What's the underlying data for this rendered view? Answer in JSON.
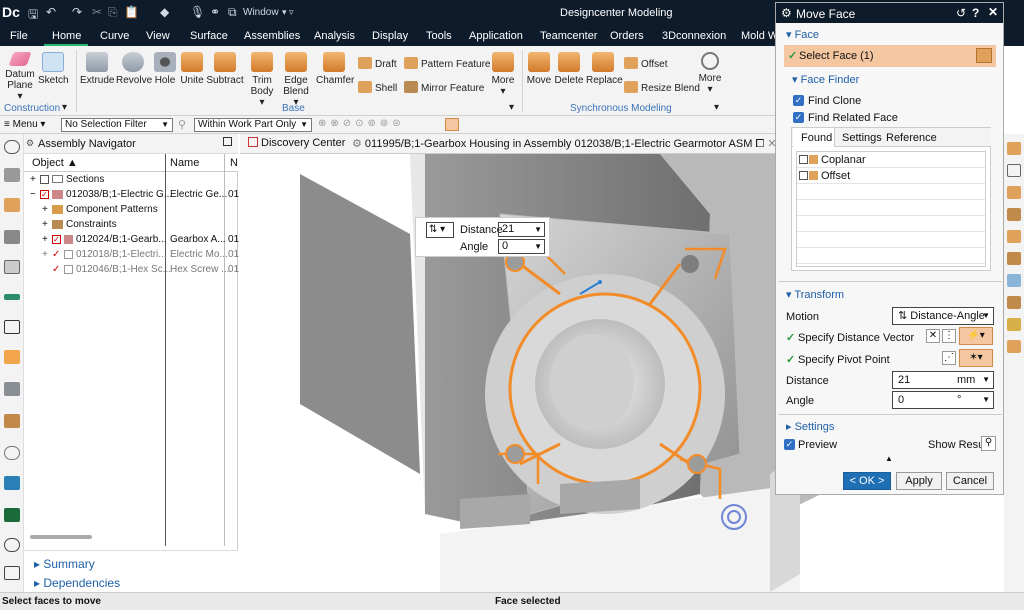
{
  "app": {
    "logo": "Dc",
    "title": "Designcenter Modeling",
    "window_menu": "Window"
  },
  "menu": [
    "File",
    "Home",
    "Curve",
    "View",
    "Surface",
    "Assemblies",
    "Analysis",
    "Display",
    "Tools",
    "Application",
    "Teamcenter",
    "Orders",
    "3Dconnexion",
    "Mold W"
  ],
  "ribbon": {
    "construction": {
      "datum_plane": "Datum",
      "datum_plane2": "Plane",
      "sketch": "Sketch",
      "label": "Construction"
    },
    "base": {
      "extrude": "Extrude",
      "revolve": "Revolve",
      "hole": "Hole",
      "unite": "Unite",
      "subtract": "Subtract",
      "trim_body": "Trim",
      "trim_body2": "Body",
      "edge_blend": "Edge",
      "edge_blend2": "Blend",
      "chamfer": "Chamfer",
      "draft": "Draft",
      "shell": "Shell",
      "pattern_feature": "Pattern Feature",
      "mirror_feature": "Mirror Feature",
      "more": "More",
      "label": "Base"
    },
    "sync": {
      "move": "Move",
      "delete": "Delete",
      "replace": "Replace",
      "offset": "Offset",
      "resize_blend": "Resize Blend",
      "more": "More",
      "label": "Synchronous Modeling"
    }
  },
  "toolbar2": {
    "menu": "Menu",
    "selection_filter": "No Selection Filter",
    "scope": "Within Work Part Only"
  },
  "navigator": {
    "title": "Assembly Navigator",
    "col_object": "Object",
    "col_name": "Name",
    "col_n": "N",
    "rows": [
      {
        "label": "Sections",
        "name": "",
        "num": ""
      },
      {
        "label": "012038/B;1-Electric G...",
        "name": "Electric Ge...",
        "num": "01"
      },
      {
        "label": "Component Patterns",
        "name": "",
        "num": ""
      },
      {
        "label": "Constraints",
        "name": "",
        "num": ""
      },
      {
        "label": "012024/B;1-Gearb...",
        "name": "Gearbox A...",
        "num": "01"
      },
      {
        "label": "012018/B;1-Electri...",
        "name": "Electric Mo...",
        "num": "01"
      },
      {
        "label": "012046/B;1-Hex Sc...",
        "name": "Hex Screw ...",
        "num": "01"
      }
    ],
    "summary": "Summary",
    "dependencies": "Dependencies"
  },
  "tabs": {
    "discovery": "Discovery Center",
    "model": "011995/B;1-Gearbox Housing in Assembly 012038/B;1-Electric Gearmotor ASM"
  },
  "handle": {
    "distance_label": "Distance",
    "distance_value": "21",
    "angle_label": "Angle",
    "angle_value": "0"
  },
  "dialog": {
    "title": "Move Face",
    "face_section": "Face",
    "select_face": "Select Face (1)",
    "face_finder": "Face Finder",
    "find_clone": "Find Clone",
    "find_related": "Find Related Face",
    "tab_found": "Found",
    "tab_settings": "Settings",
    "tab_reference": "Reference",
    "found_items": [
      "Coplanar",
      "Offset"
    ],
    "transform": "Transform",
    "motion_label": "Motion",
    "motion_value": "Distance-Angle",
    "distance_vector": "Specify Distance Vector",
    "pivot_point": "Specify Pivot Point",
    "distance_label": "Distance",
    "distance_value": "21",
    "distance_unit": "mm",
    "angle_label": "Angle",
    "angle_value": "0",
    "angle_unit": "°",
    "settings": "Settings",
    "preview": "Preview",
    "show_result": "Show Result",
    "ok": "< OK >",
    "apply": "Apply",
    "cancel": "Cancel"
  },
  "status": {
    "left": "Select faces to move",
    "center": "Face selected"
  },
  "colors": {
    "title_bg": "#0d1b2a",
    "accent_orange": "#f28c28",
    "select_highlight": "#f4c7a1",
    "ok_blue": "#1f6fb5",
    "home_underline": "#2bb673"
  }
}
